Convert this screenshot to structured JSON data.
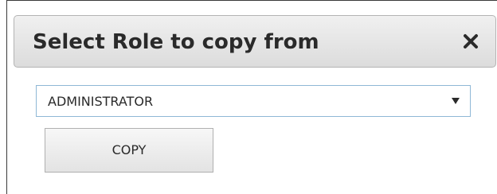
{
  "dialog": {
    "title": "Select Role to copy from",
    "close_icon": "close-icon"
  },
  "role_select": {
    "selected_value": "ADMINISTRATOR",
    "arrow_icon": "dropdown-arrow-icon"
  },
  "actions": {
    "copy_label": "COPY"
  },
  "colors": {
    "titlebar_top": "#f0f0f0",
    "titlebar_bottom": "#dcdcdc",
    "select_border": "#8fb8d6",
    "text": "#2a2a2a"
  }
}
